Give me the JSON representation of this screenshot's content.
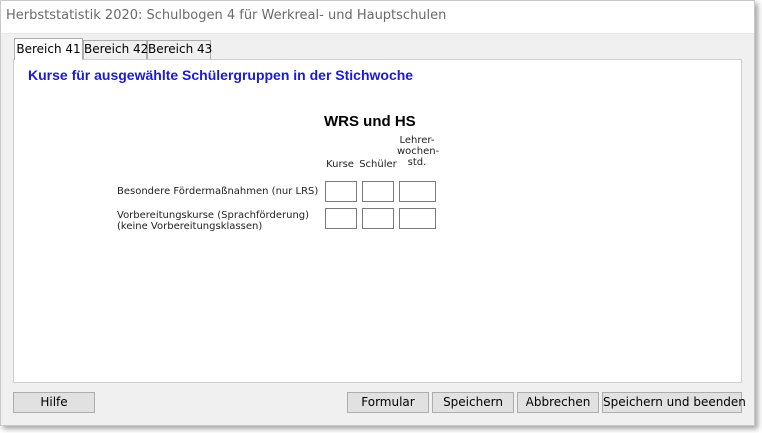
{
  "window": {
    "title": "Herbststatistik 2020: Schulbogen 4 für Werkreal- und Hauptschulen"
  },
  "tabs": [
    {
      "label": "Bereich 41",
      "active": true
    },
    {
      "label": "Bereich 42",
      "active": false
    },
    {
      "label": "Bereich 43",
      "active": false
    }
  ],
  "panel": {
    "heading": "Kurse für ausgewählte Schülergruppen in der Stichwoche",
    "group_title": "WRS und HS",
    "columns": [
      "Kurse",
      "Schüler",
      "Lehrer-\nwochen-\nstd."
    ],
    "rows": [
      {
        "label": "Besondere Fördermaßnahmen (nur LRS)",
        "values": [
          "",
          "",
          ""
        ]
      },
      {
        "label": "Vorbereitungskurse (Sprachförderung)\n(keine Vorbereitungsklassen)",
        "values": [
          "",
          "",
          ""
        ]
      }
    ]
  },
  "buttons": {
    "help": "Hilfe",
    "form": "Formular",
    "save": "Speichern",
    "cancel": "Abbrechen",
    "save_close": "Speichern und beenden"
  },
  "colors": {
    "heading": "#1a1ad6",
    "window_bg": "#f0f0f0",
    "button_bg": "#e1e1e1"
  }
}
